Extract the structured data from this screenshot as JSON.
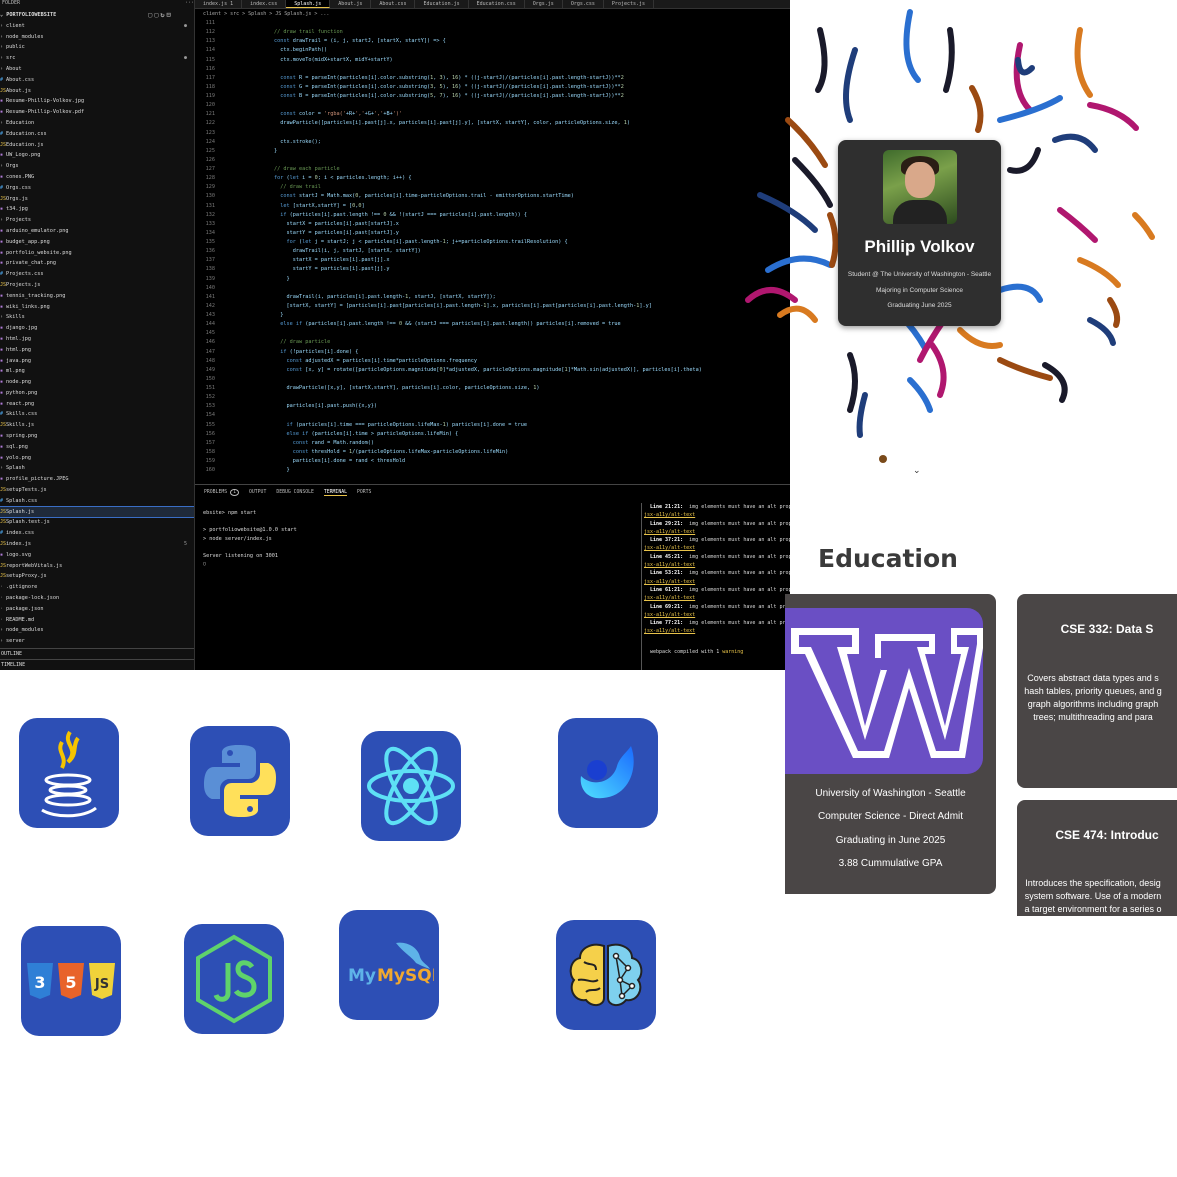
{
  "explorer": {
    "header": "FOLDER",
    "project": "PORTFOLIOWEBSITE",
    "items": [
      {
        "label": "client",
        "type": "folder",
        "badge": "●"
      },
      {
        "label": "node_modules",
        "type": "folder"
      },
      {
        "label": "public",
        "type": "folder"
      },
      {
        "label": "src",
        "type": "folder",
        "badge": "●"
      },
      {
        "label": "About",
        "type": "folder"
      },
      {
        "label": "About.css",
        "type": "css"
      },
      {
        "label": "About.js",
        "type": "js"
      },
      {
        "label": "Resume-Phillip-Volkov.jpg",
        "type": "img"
      },
      {
        "label": "Resume-Phillip-Volkov.pdf",
        "type": "img"
      },
      {
        "label": "Education",
        "type": "folder"
      },
      {
        "label": "Education.css",
        "type": "css"
      },
      {
        "label": "Education.js",
        "type": "js"
      },
      {
        "label": "UW_Logo.png",
        "type": "img"
      },
      {
        "label": "Orgs",
        "type": "folder"
      },
      {
        "label": "cones.PNG",
        "type": "img"
      },
      {
        "label": "Orgs.css",
        "type": "css"
      },
      {
        "label": "Orgs.js",
        "type": "js"
      },
      {
        "label": "t34.jpg",
        "type": "img"
      },
      {
        "label": "Projects",
        "type": "folder"
      },
      {
        "label": "arduino_emulator.png",
        "type": "img"
      },
      {
        "label": "budget_app.png",
        "type": "img"
      },
      {
        "label": "portfolio_website.png",
        "type": "img"
      },
      {
        "label": "private_chat.png",
        "type": "img"
      },
      {
        "label": "Projects.css",
        "type": "css"
      },
      {
        "label": "Projects.js",
        "type": "js"
      },
      {
        "label": "tennis_tracking.png",
        "type": "img"
      },
      {
        "label": "wiki_links.png",
        "type": "img"
      },
      {
        "label": "Skills",
        "type": "folder"
      },
      {
        "label": "django.jpg",
        "type": "img"
      },
      {
        "label": "html.jpg",
        "type": "img"
      },
      {
        "label": "html.png",
        "type": "img"
      },
      {
        "label": "java.png",
        "type": "img"
      },
      {
        "label": "ml.png",
        "type": "img"
      },
      {
        "label": "node.png",
        "type": "img"
      },
      {
        "label": "python.png",
        "type": "img"
      },
      {
        "label": "react.png",
        "type": "img"
      },
      {
        "label": "Skills.css",
        "type": "css"
      },
      {
        "label": "Skills.js",
        "type": "js"
      },
      {
        "label": "spring.png",
        "type": "img"
      },
      {
        "label": "sql.png",
        "type": "img"
      },
      {
        "label": "yolo.png",
        "type": "img"
      },
      {
        "label": "Splash",
        "type": "folder"
      },
      {
        "label": "profile_picture.JPEG",
        "type": "img"
      },
      {
        "label": "setupTests.js",
        "type": "js"
      },
      {
        "label": "Splash.css",
        "type": "css"
      },
      {
        "label": "Splash.js",
        "type": "js",
        "selected": true
      },
      {
        "label": "Splash.test.js",
        "type": "js"
      },
      {
        "label": "index.css",
        "type": "css"
      },
      {
        "label": "index.js",
        "type": "js",
        "badge": "5"
      },
      {
        "label": "logo.svg",
        "type": "img"
      },
      {
        "label": "reportWebVitals.js",
        "type": "js"
      },
      {
        "label": "setupProxy.js",
        "type": "js"
      },
      {
        "label": ".gitignore",
        "type": "file"
      },
      {
        "label": "package-lock.json",
        "type": "file"
      },
      {
        "label": "package.json",
        "type": "file"
      },
      {
        "label": "README.md",
        "type": "file"
      },
      {
        "label": "node_modules",
        "type": "folder"
      },
      {
        "label": "server",
        "type": "folder"
      }
    ],
    "outline_label": "OUTLINE",
    "timeline_label": "TIMELINE"
  },
  "editor": {
    "tabs": [
      "index.js  1",
      "index.css",
      "Splash.js",
      "About.js",
      "About.css",
      "Education.js",
      "Education.css",
      "Orgs.js",
      "Orgs.css",
      "Projects.js"
    ],
    "active_tab": 2,
    "breadcrumb": "client > src > Splash > JS Splash.js > ...",
    "lines": [
      {
        "n": "111",
        "t": ""
      },
      {
        "n": "112",
        "t": "        // draw trail function"
      },
      {
        "n": "113",
        "t": "        const drawTrail = (i, j, startJ, [startX, startY]) => {"
      },
      {
        "n": "114",
        "t": "          ctx.beginPath()"
      },
      {
        "n": "115",
        "t": "          ctx.moveTo(midX+startX, midY+startY)"
      },
      {
        "n": "116",
        "t": ""
      },
      {
        "n": "117",
        "t": "          const R = parseInt(particles[i].color.substring(1, 3), 16) * ((j-startJ)/(particles[i].past.length-startJ))**2"
      },
      {
        "n": "118",
        "t": "          const G = parseInt(particles[i].color.substring(3, 5), 16) * ((j-startJ)/(particles[i].past.length-startJ))**2"
      },
      {
        "n": "119",
        "t": "          const B = parseInt(particles[i].color.substring(5, 7), 16) * ((j-startJ)/(particles[i].past.length-startJ))**2"
      },
      {
        "n": "120",
        "t": ""
      },
      {
        "n": "121",
        "t": "          const color = 'rgba('+R+','+G+','+B+')'"
      },
      {
        "n": "122",
        "t": "          drawParticle([particles[i].past[j].x, particles[i].past[j].y], [startX, startY], color, particleOptions.size, 1)"
      },
      {
        "n": "123",
        "t": ""
      },
      {
        "n": "124",
        "t": "          ctx.stroke();"
      },
      {
        "n": "125",
        "t": "        }"
      },
      {
        "n": "126",
        "t": ""
      },
      {
        "n": "127",
        "t": "        // draw each particle"
      },
      {
        "n": "128",
        "t": "        for (let i = 0; i < particles.length; i++) {"
      },
      {
        "n": "129",
        "t": "          // draw trail"
      },
      {
        "n": "130",
        "t": "          const startJ = Math.max(0, particles[i].time-particleOptions.trail - emittorOptions.startTime)"
      },
      {
        "n": "131",
        "t": "          let [startX,startY] = [0,0]"
      },
      {
        "n": "132",
        "t": "          if (particles[i].past.length !== 0 && !(startJ === particles[i].past.length)) {"
      },
      {
        "n": "133",
        "t": "            startX = particles[i].past[startJ].x"
      },
      {
        "n": "134",
        "t": "            startY = particles[i].past[startJ].y"
      },
      {
        "n": "135",
        "t": "            for (let j = startJ; j < particles[i].past.length-1; j+=particleOptions.trailResolution) {"
      },
      {
        "n": "136",
        "t": "              drawTrail(i, j, startJ, [startX, startY])"
      },
      {
        "n": "137",
        "t": "              startX = particles[i].past[j].x"
      },
      {
        "n": "138",
        "t": "              startY = particles[i].past[j].y"
      },
      {
        "n": "139",
        "t": "            }"
      },
      {
        "n": "140",
        "t": ""
      },
      {
        "n": "141",
        "t": "            drawTrail(i, particles[i].past.length-1, startJ, [startX, startY]);"
      },
      {
        "n": "142",
        "t": "            [startX, startY] = [particles[i].past[particles[i].past.length-1].x, particles[i].past[particles[i].past.length-1].y]"
      },
      {
        "n": "143",
        "t": "          }"
      },
      {
        "n": "144",
        "t": "          else if (particles[i].past.length !== 0 && (startJ === particles[i].past.length)) particles[i].removed = true"
      },
      {
        "n": "145",
        "t": ""
      },
      {
        "n": "146",
        "t": "          // draw particle"
      },
      {
        "n": "147",
        "t": "          if (!particles[i].done) {"
      },
      {
        "n": "148",
        "t": "            const adjustedX = particles[i].time*particleOptions.frequency"
      },
      {
        "n": "149",
        "t": "            const [x, y] = rotate([particleOptions.magnitude[0]*adjustedX, particleOptions.magnitude[1]*Math.sin(adjustedX)], particles[i].theta)"
      },
      {
        "n": "150",
        "t": ""
      },
      {
        "n": "151",
        "t": "            drawParticle([x,y], [startX,startY], particles[i].color, particleOptions.size, 1)"
      },
      {
        "n": "152",
        "t": ""
      },
      {
        "n": "153",
        "t": "            particles[i].past.push({x,y})"
      },
      {
        "n": "154",
        "t": ""
      },
      {
        "n": "155",
        "t": "            if (particles[i].time === particleOptions.lifeMax-1) particles[i].done = true"
      },
      {
        "n": "156",
        "t": "            else if (particles[i].time > particleOptions.lifeMin) {"
      },
      {
        "n": "157",
        "t": "              const rand = Math.random()"
      },
      {
        "n": "158",
        "t": "              const thresHold = 1/(particleOptions.lifeMax-particleOptions.lifeMin)"
      },
      {
        "n": "159",
        "t": "              particles[i].done = rand < thresHold"
      },
      {
        "n": "160",
        "t": "            }"
      }
    ]
  },
  "panel": {
    "tabs": [
      "PROBLEMS",
      "1",
      "OUTPUT",
      "DEBUG CONSOLE",
      "TERMINAL",
      "PORTS"
    ],
    "terminal": [
      "ebsite> npm start",
      "",
      "> portfoliowebsite@1.0.0 start",
      "> node server/index.js",
      "",
      "Server listening on 3001",
      "▯"
    ],
    "warnings": [
      {
        "line": "Line 21:21:",
        "msg": "img elements must have an alt prop",
        "rule": "jsx-a11y/alt-text"
      },
      {
        "line": "Line 29:21:",
        "msg": "img elements must have an alt prop",
        "rule": "jsx-a11y/alt-text"
      },
      {
        "line": "Line 37:21:",
        "msg": "img elements must have an alt prop",
        "rule": "jsx-a11y/alt-text"
      },
      {
        "line": "Line 45:21:",
        "msg": "img elements must have an alt prop",
        "rule": "jsx-a11y/alt-text"
      },
      {
        "line": "Line 53:21:",
        "msg": "img elements must have an alt prop",
        "rule": "jsx-a11y/alt-text"
      },
      {
        "line": "Line 61:21:",
        "msg": "img elements must have an alt prop",
        "rule": "jsx-a11y/alt-text"
      },
      {
        "line": "Line 69:21:",
        "msg": "img elements must have an alt prop",
        "rule": "jsx-a11y/alt-text"
      },
      {
        "line": "Line 77:21:",
        "msg": "img elements must have an alt prop",
        "rule": "jsx-a11y/alt-text"
      }
    ],
    "compiled_prefix": "webpack compiled with 1 ",
    "compiled_warning": "warning"
  },
  "profile": {
    "name": "Phillip Volkov",
    "line1": "Student @ The University of Washington - Seattle",
    "line2": "Majoring in Computer Science",
    "line3": "Graduating June 2025",
    "scroll_icon": "chevron-down-icon"
  },
  "education": {
    "title": "Education",
    "uw": {
      "logo_letter": "W",
      "school": "University of Washington - Seattle",
      "program": "Computer Science - Direct Admit",
      "grad": "Graduating in June 2025",
      "gpa": "3.88 Cummulative GPA",
      "logo_color": "#6a4fc4"
    },
    "courses": [
      {
        "title": "CSE 332: Data S",
        "desc": [
          "Covers abstract data types and s",
          "hash tables, priority queues, and g",
          "graph algorithms including graph",
          "trees; multithreading and para"
        ]
      },
      {
        "title": "CSE 474: Introduc",
        "desc": [
          "Introduces the specification, desig",
          "system software. Use of a modern",
          "a target environment for a series o"
        ]
      }
    ]
  },
  "skills": [
    {
      "name": "java-icon"
    },
    {
      "name": "python-icon"
    },
    {
      "name": "react-icon"
    },
    {
      "name": "spring-icon"
    },
    {
      "name": "html-css-js-icon"
    },
    {
      "name": "nodejs-icon"
    },
    {
      "name": "mysql-icon",
      "label": "MySQL"
    },
    {
      "name": "ml-brain-icon"
    }
  ],
  "colors": {
    "skill_bg": "#2d4fb5",
    "card_bg": "#4a4646",
    "accent_yellow": "#e8c34a"
  }
}
